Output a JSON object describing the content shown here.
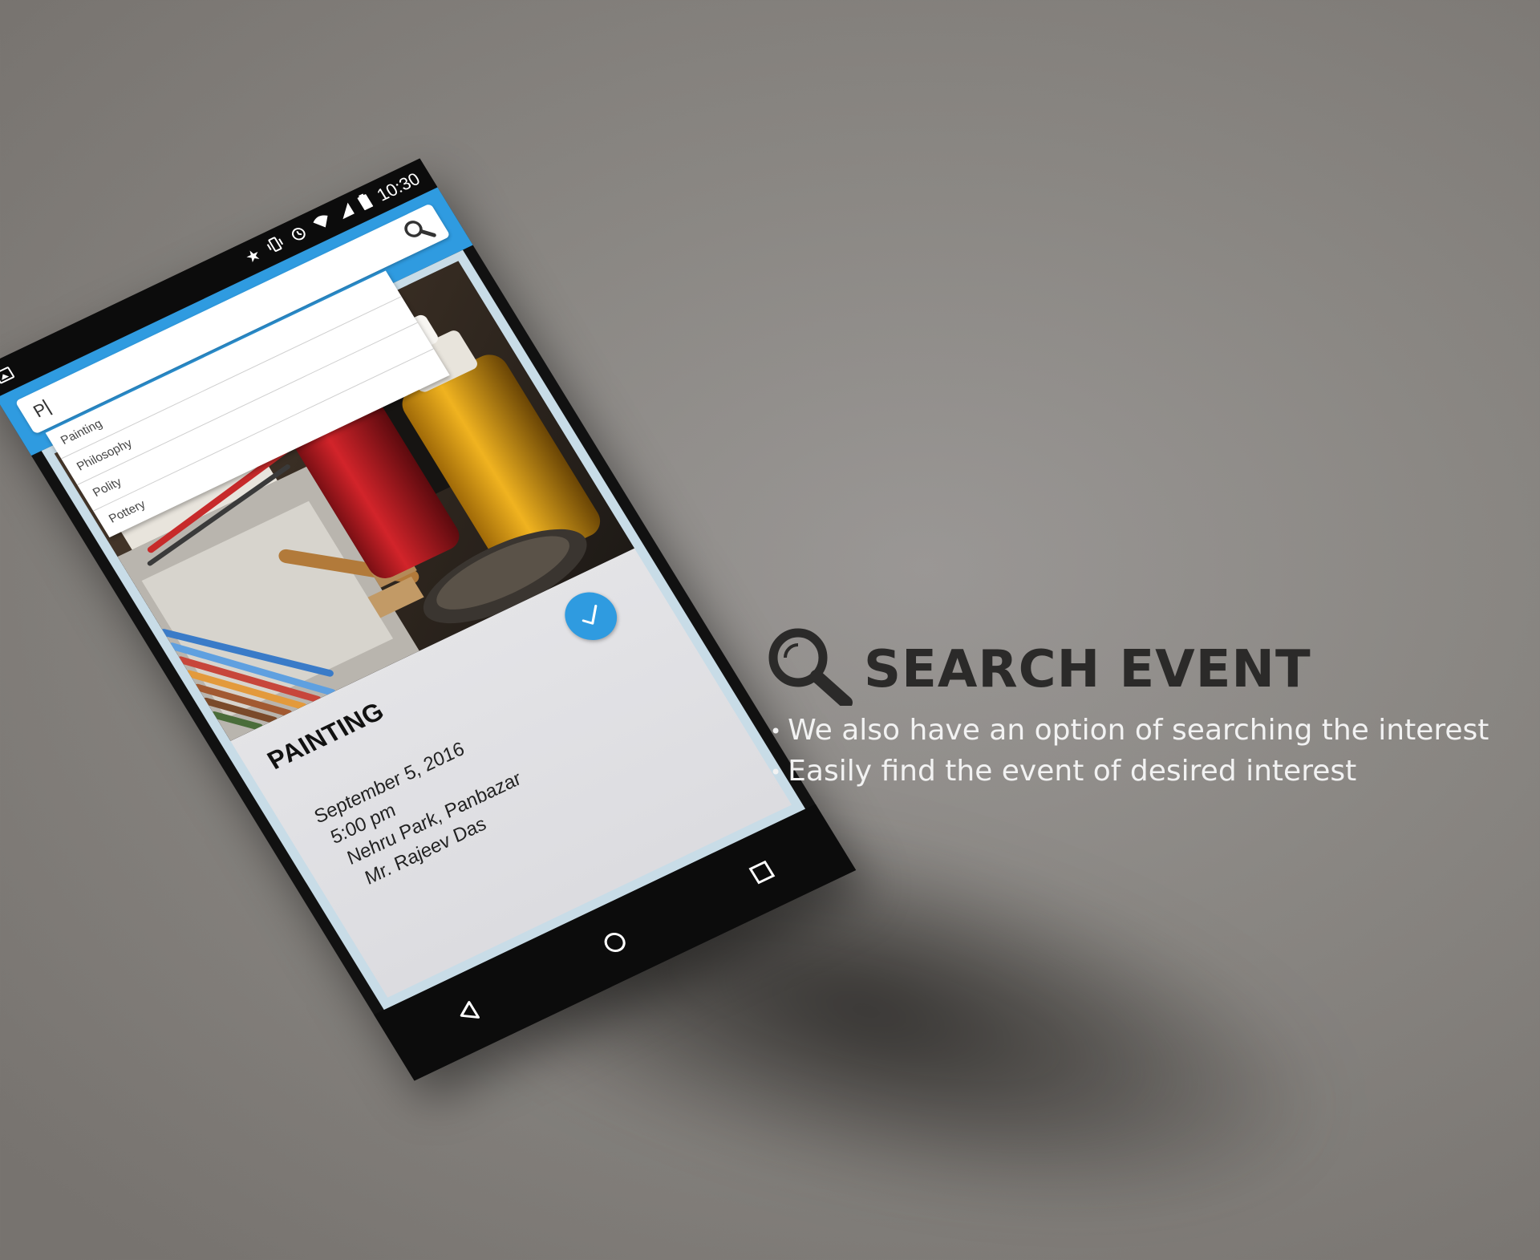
{
  "phone": {
    "status_time": "10:30",
    "search": {
      "typed_value": "P"
    },
    "suggestions": [
      "Painting",
      "Philosophy",
      "Polity",
      "Pottery"
    ],
    "event_card": {
      "title": "PAINTING",
      "date": "September 5, 2016",
      "time": "5:00 pm",
      "venue": "Nehru Park, Panbazar",
      "host": "Mr. Rajeev Das"
    },
    "accent_color": "#2f9be0"
  },
  "feature": {
    "icon": "search-icon",
    "title": "SEARCH EVENT",
    "bullets": [
      "We also have an option of searching the interest",
      "Easily find the event of desired interest"
    ]
  }
}
